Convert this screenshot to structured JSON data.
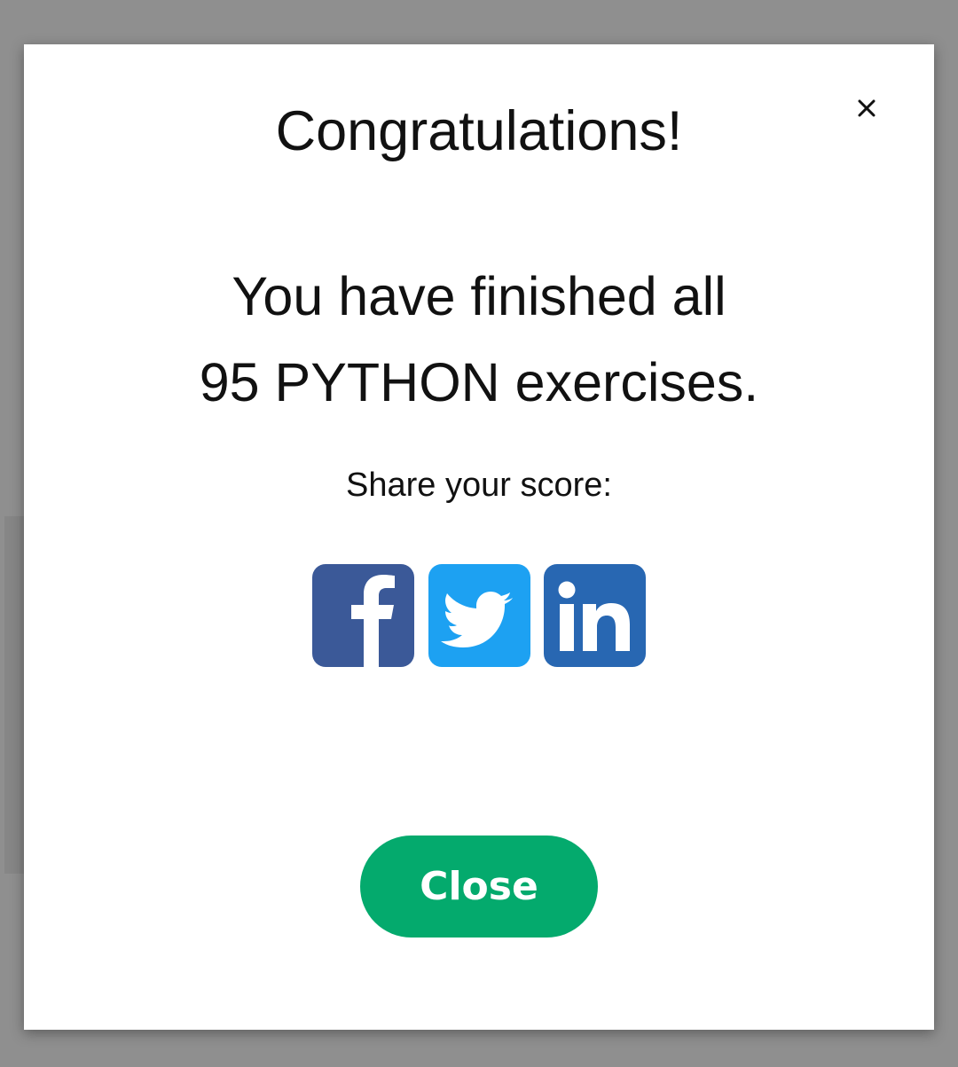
{
  "modal": {
    "title": "Congratulations!",
    "message_line1": "You have finished all",
    "message_line2": "95 PYTHON exercises.",
    "share_label": "Share your score:",
    "close_label": "Close",
    "close_icon": "close-icon"
  },
  "share": [
    {
      "network": "facebook",
      "icon": "facebook-icon",
      "color": "#3b5998"
    },
    {
      "network": "twitter",
      "icon": "twitter-icon",
      "color": "#1da1f2"
    },
    {
      "network": "linkedin",
      "icon": "linkedin-icon",
      "color": "#2867b2"
    }
  ],
  "colors": {
    "accent": "#04aa6d",
    "backdrop": "#8f8f8f",
    "text": "#111111"
  }
}
